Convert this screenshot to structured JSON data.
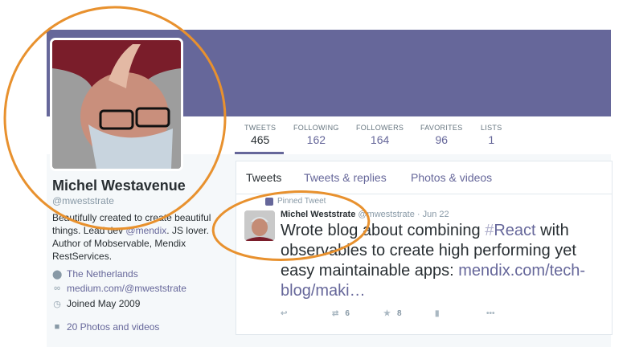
{
  "profile": {
    "name": "Michel Westavenue",
    "handle": "@mweststrate",
    "bio_pre": "Beautifully created to create beautiful things. Lead dev ",
    "bio_mention": "@mendix",
    "bio_post": ". JS lover. Author of Mobservable, Mendix RestServices.",
    "location": "The Netherlands",
    "website": "medium.com/@mweststrate",
    "joined": "Joined May 2009",
    "photos": "20 Photos and videos"
  },
  "stats": [
    {
      "label": "TWEETS",
      "value": "465"
    },
    {
      "label": "FOLLOWING",
      "value": "162"
    },
    {
      "label": "FOLLOWERS",
      "value": "164"
    },
    {
      "label": "FAVORITES",
      "value": "96"
    },
    {
      "label": "LISTS",
      "value": "1"
    }
  ],
  "tabs": [
    "Tweets",
    "Tweets & replies",
    "Photos & videos"
  ],
  "tweet": {
    "pinned_label": "Pinned Tweet",
    "author": "Michel Weststrate",
    "handle": "@mweststrate",
    "date": "· Jun 22",
    "text_pre": "Wrote blog about combining ",
    "hash_symbol": "#",
    "hashtag": "React",
    "text_mid": " with observables to create high performing yet easy maintainable apps: ",
    "link": "mendix.com/tech-blog/maki…",
    "retweets": "6",
    "favorites": "8"
  },
  "colors": {
    "brand": "#66679a",
    "annotation": "#e8912e"
  }
}
